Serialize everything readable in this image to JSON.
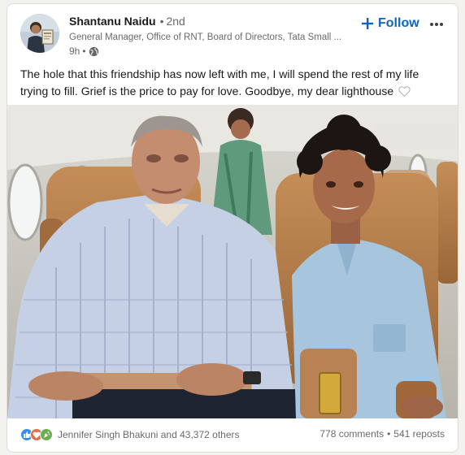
{
  "author": {
    "name": "Shantanu Naidu",
    "degree": "2nd",
    "headline": "General Manager, Office of RNT, Board of Directors, Tata Small ...",
    "time": "9h",
    "visibility_icon": "globe-icon"
  },
  "actions": {
    "follow_label": "Follow",
    "more_icon": "more-horizontal-icon"
  },
  "post": {
    "text": "The hole that this friendship has now left with me, I will spend the rest of my life trying to fill. Grief is the price to pay for love. Goodbye, my dear lighthouse",
    "trailing_icon": "heart-outline-icon"
  },
  "image": {
    "kind": "photo: two men seated in aircraft cabin"
  },
  "social": {
    "reactions_text": "Jennifer Singh Bhakuni and 43,372 others",
    "reaction_icons": [
      "like-icon",
      "love-icon",
      "celebrate-icon"
    ],
    "comments": "778 comments",
    "reposts": "541 reposts"
  },
  "colors": {
    "brand_blue": "#0a66c2",
    "like_blue": "#378fe9",
    "love_red": "#df704d",
    "celebrate_green": "#6dae4f"
  }
}
